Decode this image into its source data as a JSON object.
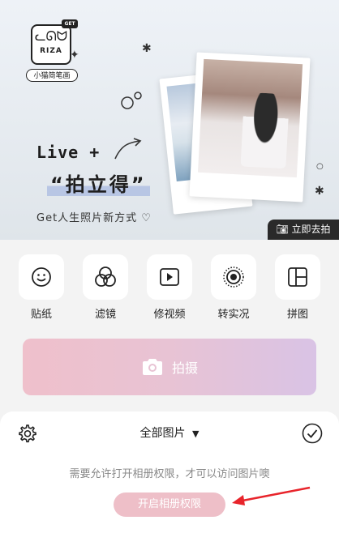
{
  "banner": {
    "logo_badge": "GET",
    "logo_text": "RIZA",
    "logo_caption": "小猫简笔画",
    "headline_line1": "Live +",
    "headline_line2": "“拍立得”",
    "slogan": "Get人生照片新方式 ♡",
    "shoot_badge": "立即去拍"
  },
  "tools": [
    {
      "label": "贴纸",
      "icon": "smiley-sticker-icon"
    },
    {
      "label": "滤镜",
      "icon": "filter-circles-icon"
    },
    {
      "label": "修视频",
      "icon": "video-play-icon"
    },
    {
      "label": "转实况",
      "icon": "live-photo-icon"
    },
    {
      "label": "拼图",
      "icon": "collage-grid-icon"
    }
  ],
  "shoot_button": {
    "label": "拍摄",
    "icon": "camera-icon"
  },
  "sheet": {
    "title": "全部图片",
    "permission_message": "需要允许打开相册权限，才可以访问图片噢",
    "permission_button": "开启相册权限"
  },
  "colors": {
    "shoot_gradient_start": "#efc0cb",
    "shoot_gradient_end": "#d9c3e5",
    "permission_button": "#eebfc8",
    "annotation_arrow": "#e8242b"
  }
}
